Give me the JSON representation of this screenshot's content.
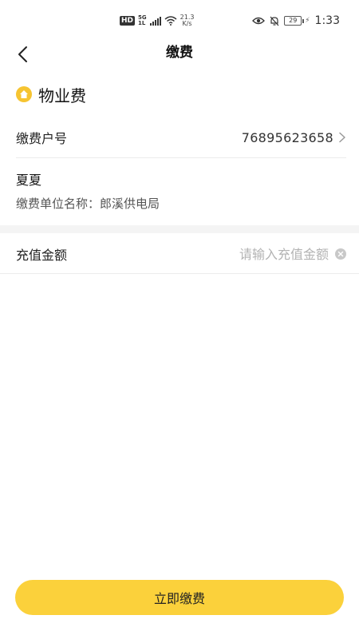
{
  "status_bar": {
    "hd": "HD",
    "network": "5G",
    "network_sub": "1L",
    "speed_value": "21.3",
    "speed_unit": "K/s",
    "battery": "29",
    "time": "1:33"
  },
  "nav": {
    "title": "缴费"
  },
  "category": {
    "title": "物业费",
    "icon": "home-icon",
    "icon_color": "#f6c431"
  },
  "account": {
    "label": "缴费户号",
    "value": "76895623658"
  },
  "payee": {
    "name": "夏夏",
    "unit_label": "缴费单位名称：",
    "unit_value": "郎溪供电局"
  },
  "amount": {
    "label": "充值金额",
    "placeholder": "请输入充值金额",
    "value": ""
  },
  "submit": {
    "label": "立即缴费",
    "color": "#fbd13b"
  }
}
